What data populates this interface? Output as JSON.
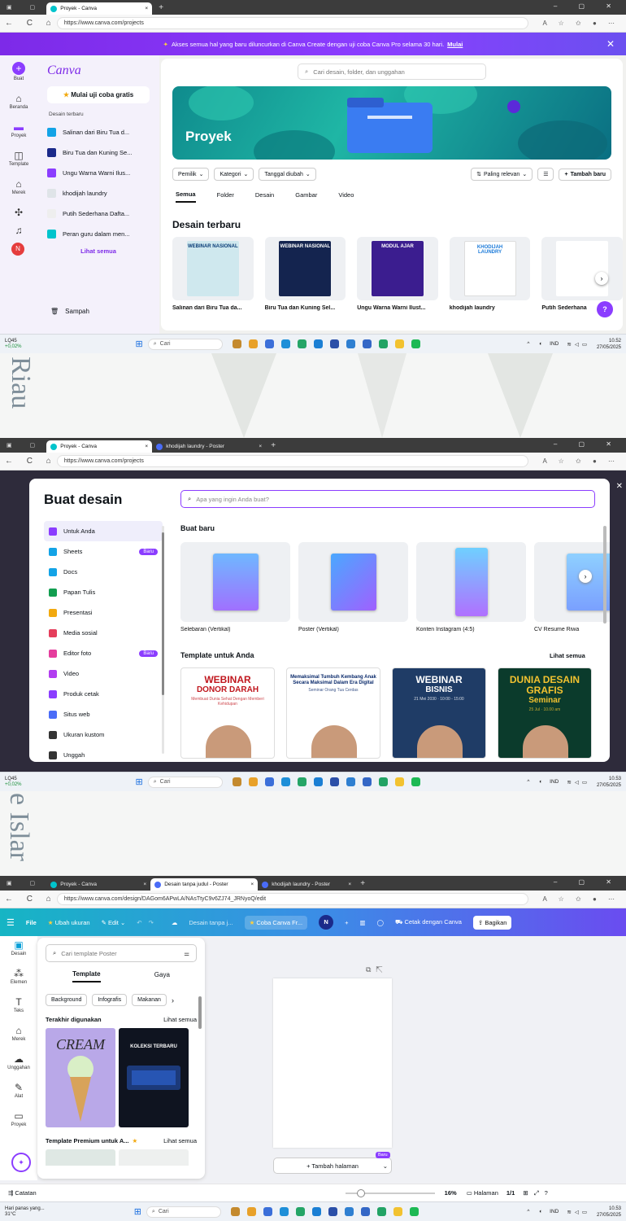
{
  "s1": {
    "tabs": [
      {
        "label": "Proyek - Canva"
      }
    ],
    "url": "https://www.canva.com/projects",
    "banner": {
      "text": "Akses semua hal yang baru diluncurkan di Canva Create dengan uji coba Canva Pro selama 30 hari.",
      "link": "Mulai"
    },
    "logo": "Canva",
    "trial": "Mulai uji coba gratis",
    "recent_title": "Desain terbaru",
    "recent": [
      {
        "label": "Salinan dari Biru Tua d..."
      },
      {
        "label": "Biru Tua dan Kuning Se..."
      },
      {
        "label": "Ungu Warna Warni Ilus..."
      },
      {
        "label": "khodijah laundry"
      },
      {
        "label": "Putih Sederhana Dafta..."
      },
      {
        "label": "Peran guru dalam men..."
      }
    ],
    "see_all": "Lihat semua",
    "trash": "Sampah",
    "rail": [
      "Buat",
      "Beranda",
      "Proyek",
      "Template",
      "Merek"
    ],
    "avatar": "N",
    "search": "Cari desain, folder, dan unggahan",
    "hero": "Proyek",
    "filters": [
      "Pemilik",
      "Kategori",
      "Tanggal diubah"
    ],
    "sort": "Paling relevan",
    "add": "Tambah baru",
    "tabs_main": [
      "Semua",
      "Folder",
      "Desain",
      "Gambar",
      "Video"
    ],
    "section": "Desain terbaru",
    "designs": [
      {
        "title": "Salinan dari Biru Tua da...",
        "thumb": "WEBINAR NASIONAL"
      },
      {
        "title": "Biru Tua dan Kuning Sel...",
        "thumb": "WEBINAR NASIONAL"
      },
      {
        "title": "Ungu Warna Warni Ilust...",
        "thumb": "MODUL AJAR"
      },
      {
        "title": "khodijah laundry",
        "thumb": "KHODIJAH LAUNDRY"
      },
      {
        "title": "Putih Sederhana",
        "thumb": ""
      }
    ],
    "help": "?",
    "task": {
      "stock": "LQ45",
      "change": "+0,02%",
      "search": "Cari",
      "lang": "IND",
      "time": "10.52",
      "date": "27/05/2025"
    }
  },
  "wm1": "Riau",
  "s2": {
    "tabs": [
      {
        "label": "Proyek - Canva"
      },
      {
        "label": "khodijah laundry - Poster"
      }
    ],
    "url": "https://www.canva.com/projects",
    "title": "Buat desain",
    "search": "Apa yang ingin Anda buat?",
    "menu": [
      {
        "label": "Untuk Anda",
        "badge": "",
        "icon": "sparkle-icon",
        "color": "#8b3dff"
      },
      {
        "label": "Sheets",
        "badge": "Baru",
        "icon": "sheet-icon",
        "color": "#13a3e6"
      },
      {
        "label": "Docs",
        "badge": "",
        "icon": "doc-icon",
        "color": "#13a3e6"
      },
      {
        "label": "Papan Tulis",
        "badge": "",
        "icon": "whiteboard-icon",
        "color": "#129e50"
      },
      {
        "label": "Presentasi",
        "badge": "",
        "icon": "presentation-icon",
        "color": "#f2a90f"
      },
      {
        "label": "Media sosial",
        "badge": "",
        "icon": "heart-icon",
        "color": "#e53d5b"
      },
      {
        "label": "Editor foto",
        "badge": "Baru",
        "icon": "photo-icon",
        "color": "#e53d9d"
      },
      {
        "label": "Video",
        "badge": "",
        "icon": "video-icon",
        "color": "#b23df0"
      },
      {
        "label": "Produk cetak",
        "badge": "",
        "icon": "print-icon",
        "color": "#8b3dff"
      },
      {
        "label": "Situs web",
        "badge": "",
        "icon": "web-icon",
        "color": "#4a6cf7"
      },
      {
        "label": "Ukuran kustom",
        "badge": "",
        "icon": "custom-size-icon",
        "color": "#333"
      },
      {
        "label": "Unggah",
        "badge": "",
        "icon": "upload-icon",
        "color": "#333"
      }
    ],
    "new_title": "Buat baru",
    "new_items": [
      "Selebaran (Vertikal)",
      "Poster (Vertikal)",
      "Konten Instagram (4:5)",
      "CV Resume Riwa"
    ],
    "tpl_title": "Template untuk Anda",
    "tpl_see": "Lihat semua",
    "templates": [
      {
        "big": "WEBINAR",
        "sub": "DONOR DARAH",
        "small": "Membuat Dunia Sehat Dengan Memberi Kehidupan"
      },
      {
        "big": "Memaksimal Tumbuh Kembang Anak Secara Maksimal Dalam Era Digital",
        "sub": "",
        "small": "Seminar Orang Tua Cerdas"
      },
      {
        "big": "WEBINAR",
        "sub": "BISNIS",
        "small": "21 Mei 2030 · 10:00 - 15:00"
      },
      {
        "big": "DUNIA DESAIN GRAFIS",
        "sub": "Seminar",
        "small": "25 Jul · 10.00 am"
      }
    ],
    "task": {
      "stock": "LQ45",
      "change": "+0,02%",
      "search": "Cari",
      "lang": "IND",
      "time": "10.53",
      "date": "27/05/2025"
    }
  },
  "wm2": "e Islar",
  "s3": {
    "tabs": [
      {
        "label": "Proyek - Canva"
      },
      {
        "label": "Desain tanpa judul - Poster"
      },
      {
        "label": "khodijah laundry - Poster"
      }
    ],
    "url": "https://www.canva.com/design/DAGom6APwLA/NAsTtyC9v6ZJ74_JRNyoQ/edit",
    "toolbar": {
      "file": "File",
      "resize": "Ubah ukuran",
      "edit": "Edit",
      "docname": "Desain tanpa j...",
      "trial": "Coba Canva Fr...",
      "avatar": "N",
      "print": "Cetak dengan Canva",
      "share": "Bagikan"
    },
    "rail": [
      "Desain",
      "Elemen",
      "Teks",
      "Merek",
      "Unggahan",
      "Alat",
      "Proyek"
    ],
    "search": "Cari template Poster",
    "ptabs": [
      "Template",
      "Gaya"
    ],
    "chips": [
      "Background",
      "Infografis",
      "Makanan"
    ],
    "recent_title": "Terakhir digunakan",
    "see_all": "Lihat semua",
    "thumbs": [
      {
        "text": "CREAM"
      },
      {
        "text": "KOLEKSI TERBARU"
      }
    ],
    "premium_title": "Template Premium untuk A...",
    "see_all2": "Lihat semua",
    "add_page": "+ Tambah halaman",
    "new_badge": "Baru",
    "bottom": {
      "notes": "Catatan",
      "zoom": "16%",
      "pages": "Halaman",
      "count": "1/1"
    },
    "task": {
      "weather": "Hari panas yang...",
      "temp": "31°C",
      "search": "Cari",
      "lang": "IND",
      "time": "10.53",
      "date": "27/05/2025"
    }
  }
}
